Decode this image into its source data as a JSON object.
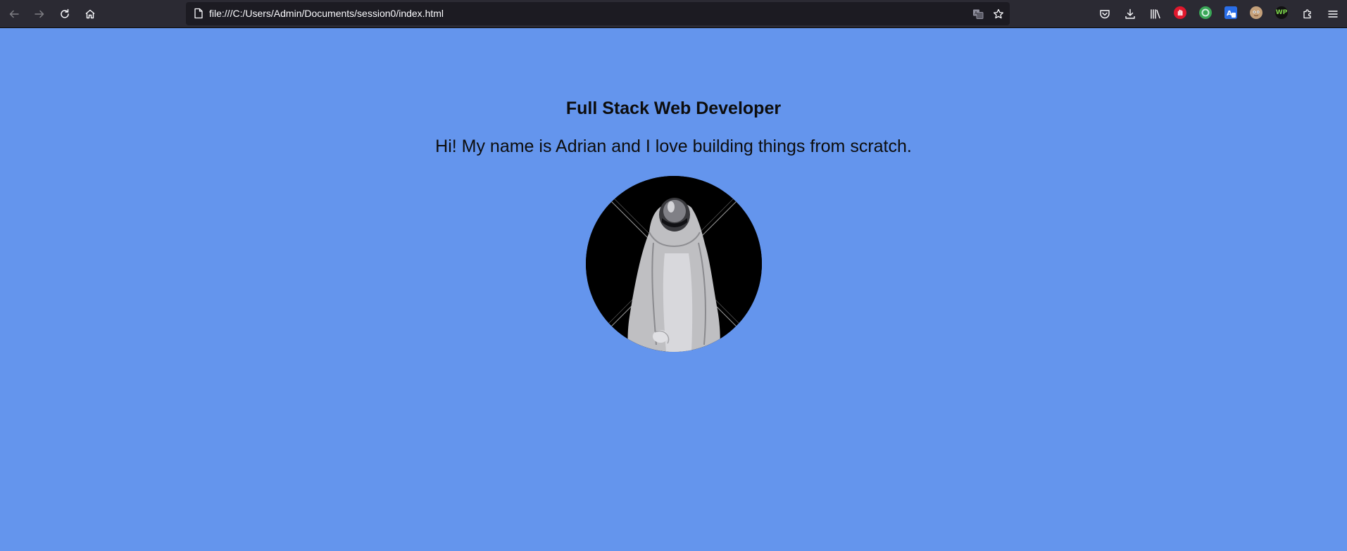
{
  "browser": {
    "url": "file:///C:/Users/Admin/Documents/session0/index.html",
    "nav": {
      "back": "back-arrow-icon",
      "forward": "forward-arrow-icon",
      "reload": "reload-icon",
      "home": "home-icon"
    },
    "url_actions": [
      "translate-icon",
      "bookmark-star-icon"
    ],
    "toolbar_icons": [
      "pocket-icon",
      "download-icon",
      "library-icon"
    ],
    "extensions": [
      {
        "name": "red-hand-extension-icon",
        "color": "#e0182d"
      },
      {
        "name": "green-circle-extension-icon",
        "color": "#3aa757"
      },
      {
        "name": "translate-extension-icon",
        "color": "#2a6ee8"
      },
      {
        "name": "face-extension-icon",
        "color": "#c4a07a"
      },
      {
        "name": "wp-extension-icon",
        "color": "#111111",
        "text": "WP"
      }
    ],
    "extensions_button": "puzzle-icon",
    "menu_button": "hamburger-menu-icon"
  },
  "page": {
    "background": "#6495ed",
    "title": "Full Stack Web Developer",
    "intro": "Hi! My name is Adrian and I love building things from scratch."
  }
}
